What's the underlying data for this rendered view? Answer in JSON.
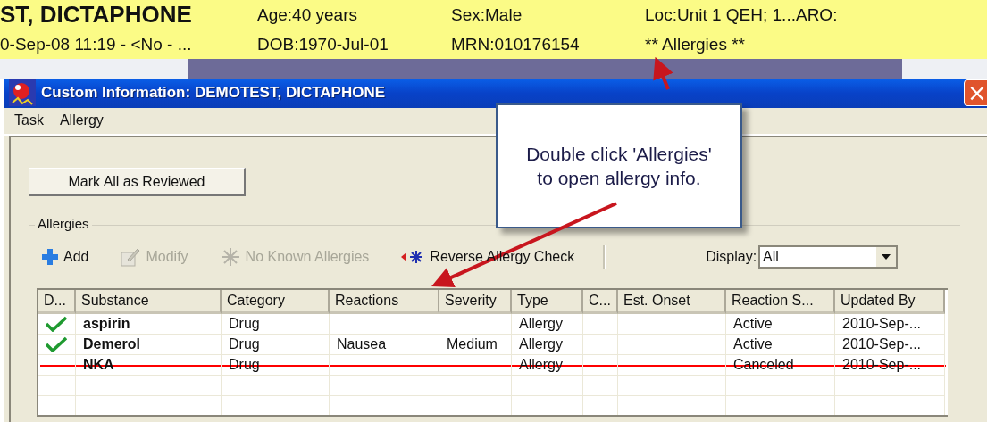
{
  "banner": {
    "name": "ST, DICTAPHONE",
    "encounter": "0-Sep-08 11:19 - <No - ...",
    "age": "Age:40 years",
    "dob": "DOB:1970-Jul-01",
    "sex": "Sex:Male",
    "mrn": "MRN:010176154",
    "location": "Loc:Unit 1 QEH; 1...ARO:",
    "allergies_link": "** Allergies **"
  },
  "window": {
    "title": "Custom Information: DEMOTEST, DICTAPHONE",
    "close": "×"
  },
  "menu": [
    {
      "label": "Task"
    },
    {
      "label": "Allergy"
    }
  ],
  "review_button": {
    "label": "Mark All as Reviewed"
  },
  "group": {
    "title": "Allergies"
  },
  "toolbar": [
    {
      "kind": "add",
      "label": "Add",
      "disabled": false
    },
    {
      "kind": "modify",
      "label": "Modify",
      "disabled": true
    },
    {
      "kind": "nka",
      "label": "No Known Allergies",
      "disabled": true
    },
    {
      "kind": "reverse",
      "label": "Reverse Allergy Check",
      "disabled": false
    }
  ],
  "display": {
    "label": "Display:",
    "value": "All"
  },
  "table": {
    "columns": [
      "D...",
      "Substance",
      "Category",
      "Reactions",
      "Severity",
      "Type",
      "C...",
      "Est. Onset",
      "Reaction S...",
      "Updated By"
    ],
    "rows": [
      {
        "reviewed": true,
        "canceled": false,
        "cells": [
          "",
          "aspirin",
          "Drug",
          "",
          "",
          "Allergy",
          "",
          "",
          "Active",
          "2010-Sep-..."
        ]
      },
      {
        "reviewed": true,
        "canceled": false,
        "cells": [
          "",
          "Demerol",
          "Drug",
          "Nausea",
          "Medium",
          "Allergy",
          "",
          "",
          "Active",
          "2010-Sep-..."
        ]
      },
      {
        "reviewed": false,
        "canceled": true,
        "cells": [
          "",
          "NKA",
          "Drug",
          "",
          "",
          "Allergy",
          "",
          "",
          "Canceled",
          "2010-Sep-..."
        ]
      }
    ]
  },
  "callout": {
    "text": "Double click 'Allergies' to open allergy info."
  }
}
